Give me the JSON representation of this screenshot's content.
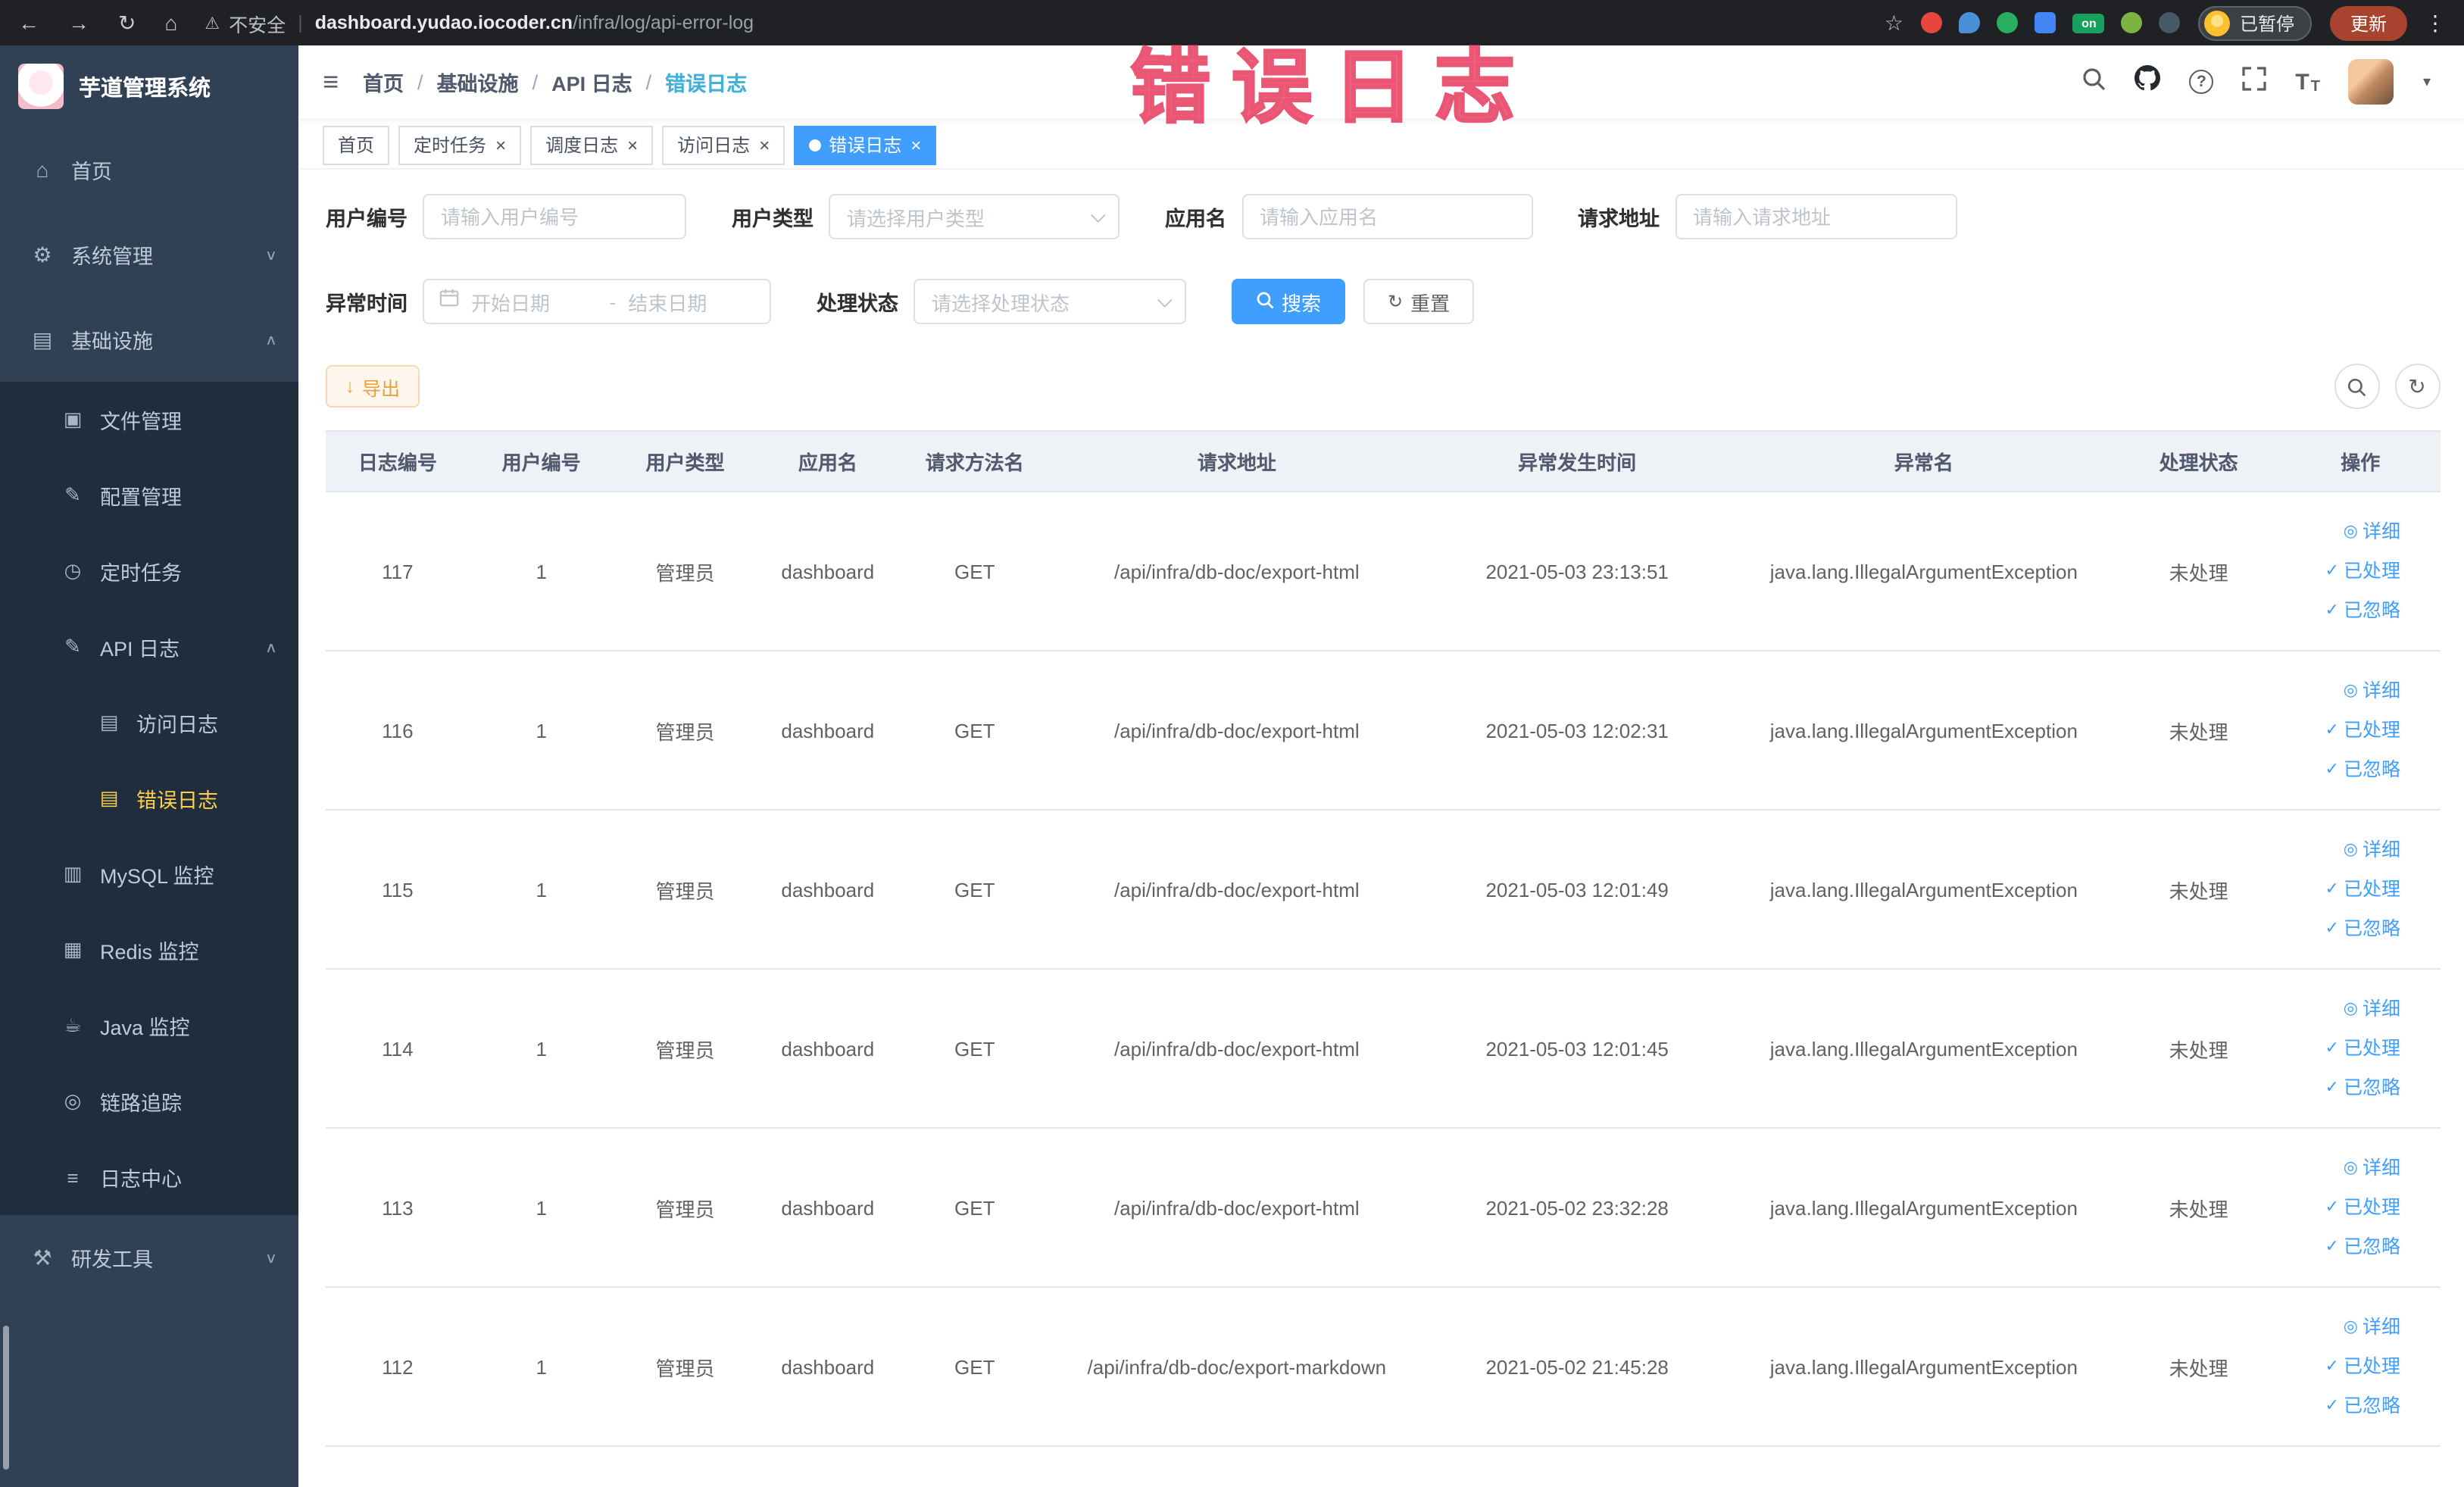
{
  "theme": {
    "accent": "#409eff",
    "chrome_bg": "#202124",
    "sidebar_bg": "#304156",
    "submenu_bg": "#1f2d3d",
    "sidebar_text": "#bfcbd9",
    "menu_active": "#ffd04b",
    "breadcrumb_last": "#45b0d6",
    "table_header_bg": "#eef1f6",
    "table_border": "#dfe6ec",
    "text_primary": "#303133",
    "placeholder": "#bfc4cc",
    "warning_text": "#e6a23c",
    "warning_bg": "#fdf6ec",
    "warning_border": "#f5dab1",
    "annotation": "#ef4868",
    "update_btn_bg": "#a8432f"
  },
  "glyphs": {
    "back": "←",
    "forward": "→",
    "reload": "↻",
    "home": "⌂",
    "warning": "⚠",
    "divider": "|",
    "star": "☆",
    "kebab": "⋮",
    "hamburger": "≡",
    "help": "?",
    "font_size_large": "T",
    "font_size_small": "T",
    "caret_down": "▾"
  },
  "browser": {
    "security_label": "不安全",
    "url_domain": "dashboard.yudao.iocoder.cn",
    "url_path": "/infra/log/api-error-log",
    "profile_label": "已暂停",
    "update_label": "更新",
    "extensions": [
      {
        "name": "extension-icon-red",
        "color": "#e8453c",
        "shape": "circle",
        "label": ""
      },
      {
        "name": "extension-icon-blue-drop",
        "color": "#4a90d9",
        "shape": "drop",
        "label": ""
      },
      {
        "name": "extension-icon-green-circle",
        "color": "#27ae60",
        "shape": "circle",
        "label": ""
      },
      {
        "name": "extension-icon-blue-grid",
        "color": "#4285f4",
        "shape": "square",
        "label": ""
      },
      {
        "name": "extension-icon-on-badge",
        "color": "#18a05e",
        "shape": "pill",
        "label": "on"
      },
      {
        "name": "extension-icon-leaf",
        "color": "#7cb342",
        "shape": "circle",
        "label": ""
      },
      {
        "name": "extension-icon-paw",
        "color": "#455a64",
        "shape": "circle",
        "label": ""
      }
    ]
  },
  "annotation": {
    "text": "错误日志"
  },
  "sidebar": {
    "logo_title": "芋道管理系统",
    "top_items": [
      {
        "label": "首页",
        "icon": "⌂"
      },
      {
        "label": "系统管理",
        "icon": "⚙",
        "chevron": "∨"
      },
      {
        "label": "基础设施",
        "icon": "▤",
        "chevron": "∧"
      }
    ],
    "infra_children": [
      {
        "label": "文件管理",
        "icon": "▣"
      },
      {
        "label": "配置管理",
        "icon": "✎"
      },
      {
        "label": "定时任务",
        "icon": "◷"
      },
      {
        "label": "API 日志",
        "icon": "✎",
        "chevron": "∧"
      },
      {
        "label": "MySQL 监控",
        "icon": "▥"
      },
      {
        "label": "Redis 监控",
        "icon": "▦"
      },
      {
        "label": "Java 监控",
        "icon": "☕"
      },
      {
        "label": "链路追踪",
        "icon": "◎"
      },
      {
        "label": "日志中心",
        "icon": "≡"
      }
    ],
    "api_children": [
      {
        "label": "访问日志",
        "icon": "▤"
      },
      {
        "label": "错误日志",
        "icon": "▤",
        "active": true
      }
    ],
    "bottom_items": [
      {
        "label": "研发工具",
        "icon": "⚒",
        "chevron": "∨"
      }
    ]
  },
  "header": {
    "breadcrumb": [
      "首页",
      "基础设施",
      "API 日志",
      "错误日志"
    ],
    "breadcrumb_separator": "/"
  },
  "tabs": {
    "close_glyph": "×",
    "items": [
      {
        "label": "首页",
        "closable": false,
        "active": false
      },
      {
        "label": "定时任务",
        "closable": true,
        "active": false
      },
      {
        "label": "调度日志",
        "closable": true,
        "active": false
      },
      {
        "label": "访问日志",
        "closable": true,
        "active": false
      },
      {
        "label": "错误日志",
        "closable": true,
        "active": true
      }
    ]
  },
  "filters": {
    "user_id": {
      "label": "用户编号",
      "placeholder": "请输入用户编号"
    },
    "user_type": {
      "label": "用户类型",
      "placeholder": "请选择用户类型"
    },
    "app_name": {
      "label": "应用名",
      "placeholder": "请输入应用名"
    },
    "request_url": {
      "label": "请求地址",
      "placeholder": "请输入请求地址"
    },
    "exception_time": {
      "label": "异常时间",
      "start_placeholder": "开始日期",
      "separator": "-",
      "end_placeholder": "结束日期"
    },
    "process_status": {
      "label": "处理状态",
      "placeholder": "请选择处理状态"
    },
    "search_label": "搜索",
    "reset_label": "重置",
    "reset_icon": "↻"
  },
  "toolbar": {
    "export_label": "导出",
    "export_icon": "↓",
    "refresh_icon": "↻"
  },
  "table": {
    "headers": [
      "日志编号",
      "用户编号",
      "用户类型",
      "应用名",
      "请求方法名",
      "请求地址",
      "异常发生时间",
      "异常名",
      "处理状态",
      "操作"
    ],
    "fields": [
      "id",
      "user_id",
      "user_type",
      "app_name",
      "method",
      "url",
      "time",
      "exception",
      "status"
    ],
    "rows": [
      {
        "id": "117",
        "user_id": "1",
        "user_type": "管理员",
        "app_name": "dashboard",
        "method": "GET",
        "url": "/api/infra/db-doc/export-html",
        "time": "2021-05-03 23:13:51",
        "exception": "java.lang.IllegalArgumentException",
        "status": "未处理"
      },
      {
        "id": "116",
        "user_id": "1",
        "user_type": "管理员",
        "app_name": "dashboard",
        "method": "GET",
        "url": "/api/infra/db-doc/export-html",
        "time": "2021-05-03 12:02:31",
        "exception": "java.lang.IllegalArgumentException",
        "status": "未处理"
      },
      {
        "id": "115",
        "user_id": "1",
        "user_type": "管理员",
        "app_name": "dashboard",
        "method": "GET",
        "url": "/api/infra/db-doc/export-html",
        "time": "2021-05-03 12:01:49",
        "exception": "java.lang.IllegalArgumentException",
        "status": "未处理"
      },
      {
        "id": "114",
        "user_id": "1",
        "user_type": "管理员",
        "app_name": "dashboard",
        "method": "GET",
        "url": "/api/infra/db-doc/export-html",
        "time": "2021-05-03 12:01:45",
        "exception": "java.lang.IllegalArgumentException",
        "status": "未处理"
      },
      {
        "id": "113",
        "user_id": "1",
        "user_type": "管理员",
        "app_name": "dashboard",
        "method": "GET",
        "url": "/api/infra/db-doc/export-html",
        "time": "2021-05-02 23:32:28",
        "exception": "java.lang.IllegalArgumentException",
        "status": "未处理"
      },
      {
        "id": "112",
        "user_id": "1",
        "user_type": "管理员",
        "app_name": "dashboard",
        "method": "GET",
        "url": "/api/infra/db-doc/export-markdown",
        "time": "2021-05-02 21:45:28",
        "exception": "java.lang.IllegalArgumentException",
        "status": "未处理"
      }
    ],
    "row_actions": [
      {
        "name": "detail",
        "label": "详细",
        "icon": "◎"
      },
      {
        "name": "processed",
        "label": "已处理",
        "icon": "✓"
      },
      {
        "name": "ignored",
        "label": "已忽略",
        "icon": "✓"
      }
    ]
  }
}
